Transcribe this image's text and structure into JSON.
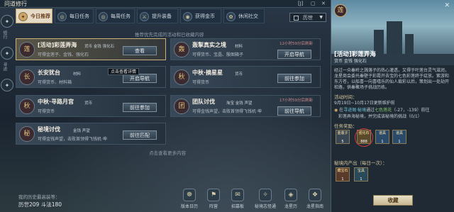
{
  "window": {
    "title": "问道修行",
    "btn_pin": "[J]",
    "btn_min": "▢",
    "btn_close": "✕"
  },
  "tabs": [
    {
      "label": "今日推荐",
      "icon": "✦"
    },
    {
      "label": "每日任务",
      "icon": "◎"
    },
    {
      "label": "每周任务",
      "icon": "◎"
    },
    {
      "label": "提升装备",
      "icon": "⚔"
    },
    {
      "label": "获得金币",
      "icon": "◉"
    },
    {
      "label": "休闲社交",
      "icon": "✿"
    }
  ],
  "server_filter": "历世",
  "hint_top": "推荐优先完成的活动和已收藏内容",
  "cards": [
    {
      "title": "[活动]彩莲弄海",
      "tags": "货币  金钱  强化石",
      "desc": "可得金莲子、金钱、强化石",
      "button": "查看",
      "icon": "莲"
    },
    {
      "title": "轰掣真实之境",
      "tags": "材料",
      "desc": "可得货币、宝晶、殷图箱子",
      "button": "开启导航",
      "timer": "12小时59分后刷新",
      "icon": "轰"
    },
    {
      "title": "长安犹台",
      "tags": "材料",
      "desc": "可得货币、材料箱",
      "button": "开启导航",
      "icon": "长"
    },
    {
      "title": "中秋·摘星星",
      "tags": "货币",
      "desc": "可得货币",
      "button": "前往参加",
      "icon": "秋"
    },
    {
      "title": "中秋·寻路月宫",
      "tags": "货币",
      "desc": "可得货币",
      "button": "前往参加",
      "icon": "秋"
    },
    {
      "title": "团队讨伐",
      "tags": "淘宝  金钱  声望",
      "desc": "可得金钱声望，击败首领得飞钱机·坤",
      "button": "前往导航",
      "timer": "17小时59分后刷新",
      "icon": "团"
    },
    {
      "title": "秘境讨伐",
      "tags": "金钱  声望",
      "desc": "可得金钱声望，击败首领得飞钱机·坤",
      "button": "前往匹配",
      "icon": "秘"
    }
  ],
  "tooltip": "点击查看详情",
  "more_text": "点击查看更多内容",
  "score": {
    "label": "我的历史最高装等：",
    "value": "历世209 斗法180"
  },
  "left_rail": {
    "btn1": "✦",
    "btn2": "✦",
    "btn3": "✦",
    "text1": "修行",
    "text2": "寻迹"
  },
  "bottom_nav": [
    {
      "label": "版本日历",
      "icon": "☸"
    },
    {
      "label": "阵营",
      "icon": "⚑"
    },
    {
      "label": "招募板",
      "icon": "✉"
    },
    {
      "label": "秘境志怪通",
      "icon": "✧"
    },
    {
      "label": "龙星历",
      "icon": "◈"
    },
    {
      "label": "龙星指南",
      "icon": "❖"
    }
  ],
  "detail": {
    "close": "✕",
    "name": "[活动]彩莲弄海",
    "tags": "货币  金钱  强化石",
    "desc": "经过一众秦岭之溅落子的热心灌透，又得于叶莲台灵气滋润，龙星商会委托秦壁子彩霞开去宝的七色彩莲终于绽放。紫游和东方苍，以船喜一向喜嘻乐的仙人裁彩以后，策划出一处劫开检路，供秦聚场子挑战历练。",
    "time_label": "活动时间：",
    "time_value": "9月19日~10月17日更新维护前",
    "time_icon": "◉",
    "obj_prefix": "在",
    "obj_loc": "寻迹阁·秘境",
    "obj_mid": "通过",
    "obj_path": "七色莲花",
    "obj_suffix": "（-27，-139）前往",
    "obj_line2": "彩莲弄海秘境，并完成该秘境的挑战（0/1）",
    "task_reward_label": "任务奖励：",
    "rewards": [
      {
        "name": "金莲子",
        "qty": "5"
      },
      {
        "name": "强化石",
        "qty": "888"
      },
      {
        "name": "道具",
        "qty": "1"
      },
      {
        "name": "道具",
        "qty": "1"
      }
    ],
    "secret_label": "秘境内产出（每日一次）：",
    "secret_rewards": [
      {
        "name": "藏宝石",
        "qty": "1"
      },
      {
        "name": "宝具",
        "qty": "1"
      }
    ],
    "collect_button": "收藏",
    "emblem": "莲"
  }
}
